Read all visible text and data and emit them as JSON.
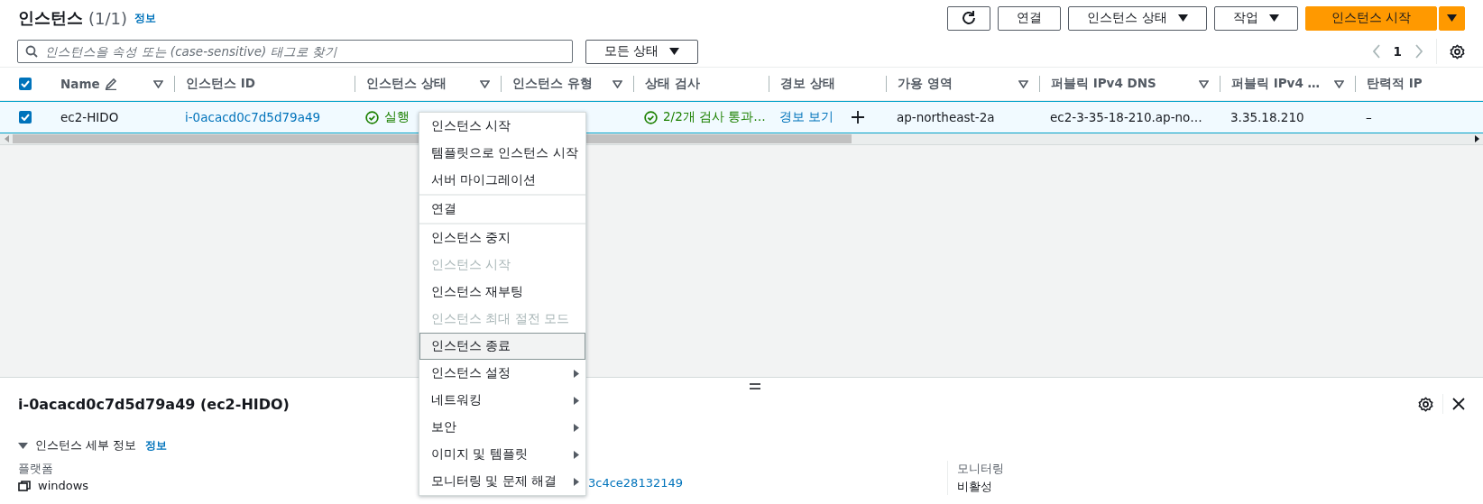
{
  "header": {
    "title": "인스턴스",
    "count": "(1/1)",
    "info": "정보"
  },
  "actions": [
    {
      "kind": "refresh"
    },
    {
      "kind": "button",
      "label": "연결"
    },
    {
      "kind": "dropdown",
      "label": "인스턴스 상태"
    },
    {
      "kind": "dropdown",
      "label": "작업"
    },
    {
      "kind": "primary",
      "label": "인스턴스 시작"
    },
    {
      "kind": "primary-caret"
    }
  ],
  "search": {
    "placeholder": "인스턴스을 속성 또는 (case-sensitive) 태그로 찾기"
  },
  "state_filter": {
    "label": "모든 상태"
  },
  "pagination": {
    "page": "1"
  },
  "table": {
    "select_all_checked": true,
    "columns": [
      {
        "label": "Name",
        "editable": true,
        "filter": true
      },
      {
        "label": "인스턴스 ID",
        "editable": false,
        "filter": false
      },
      {
        "label": "인스턴스 상태",
        "editable": false,
        "filter": true
      },
      {
        "label": "인스턴스 유형",
        "editable": false,
        "filter": true
      },
      {
        "label": "상태 검사",
        "editable": false,
        "filter": false
      },
      {
        "label": "경보 상태",
        "editable": false,
        "filter": false
      },
      {
        "label": "가용 영역",
        "editable": false,
        "filter": true
      },
      {
        "label": "퍼블릭 IPv4 DNS",
        "editable": false,
        "filter": true
      },
      {
        "label": "퍼블릭 IPv4 …",
        "editable": false,
        "filter": true
      },
      {
        "label": "탄력적 IP",
        "editable": false,
        "filter": false
      }
    ],
    "rows": [
      {
        "checked": true,
        "cells": [
          {
            "kind": "text",
            "text": "ec2-HIDO"
          },
          {
            "kind": "link",
            "text": "i-0acacd0c7d5d79a49"
          },
          {
            "kind": "status",
            "text": "실행"
          },
          {
            "kind": "covered"
          },
          {
            "kind": "status",
            "text": "2/2개 검사 통과…"
          },
          {
            "kind": "alarm",
            "text": "경보 보기"
          },
          {
            "kind": "text",
            "text": "ap-northeast-2a"
          },
          {
            "kind": "text",
            "text": "ec2-3-35-18-210.ap-no…"
          },
          {
            "kind": "text",
            "text": "3.35.18.210"
          },
          {
            "kind": "text",
            "text": "–"
          }
        ]
      }
    ]
  },
  "context_menu": {
    "groups": [
      [
        {
          "label": "인스턴스 시작",
          "kind": "item",
          "disabled": false,
          "focused": false
        },
        {
          "label": "템플릿으로 인스턴스 시작",
          "kind": "item",
          "disabled": false,
          "focused": false
        },
        {
          "label": "서버 마이그레이션",
          "kind": "item",
          "disabled": false,
          "focused": false
        }
      ],
      [
        {
          "label": "연결",
          "kind": "item",
          "disabled": false,
          "focused": false
        }
      ],
      [
        {
          "label": "인스턴스 중지",
          "kind": "item",
          "disabled": false,
          "focused": false
        },
        {
          "label": "인스턴스 시작",
          "kind": "item",
          "disabled": true,
          "focused": false
        },
        {
          "label": "인스턴스 재부팅",
          "kind": "item",
          "disabled": false,
          "focused": false
        },
        {
          "label": "인스턴스 최대 절전 모드",
          "kind": "item",
          "disabled": true,
          "focused": false
        },
        {
          "label": "인스턴스 종료",
          "kind": "item",
          "disabled": false,
          "focused": true
        },
        {
          "label": "인스턴스 설정",
          "kind": "submenu",
          "disabled": false,
          "focused": false
        },
        {
          "label": "네트워킹",
          "kind": "submenu",
          "disabled": false,
          "focused": false
        },
        {
          "label": "보안",
          "kind": "submenu",
          "disabled": false,
          "focused": false
        },
        {
          "label": "이미지 및 템플릿",
          "kind": "submenu",
          "disabled": false,
          "focused": false
        },
        {
          "label": "모니터링 및 문제 해결",
          "kind": "submenu",
          "disabled": false,
          "focused": false
        }
      ]
    ]
  },
  "details": {
    "title": "i-0acacd0c7d5d79a49 (ec2-HIDO)",
    "section": {
      "label": "인스턴스 세부 정보",
      "info": "정보",
      "expanded": true
    },
    "fields": [
      {
        "label": "플랫폼",
        "value": "windows",
        "kind": "platform"
      },
      {
        "kind": "link-only",
        "value": "3c4ce28132149"
      },
      {
        "label": "모니터링",
        "value": "비활성",
        "kind": "text"
      }
    ]
  }
}
